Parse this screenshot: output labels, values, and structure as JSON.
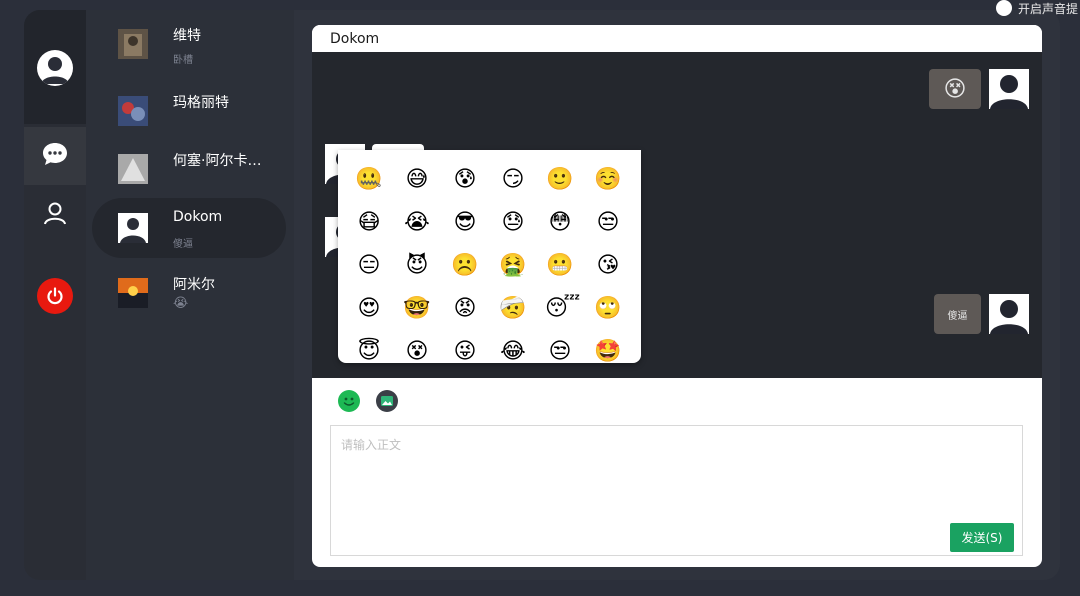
{
  "sound_toggle": {
    "label": "开启声音提",
    "enabled": false
  },
  "rail": {
    "items": [
      {
        "name": "chat",
        "icon": "chat-bubble-icon",
        "active": true
      },
      {
        "name": "contacts",
        "icon": "user-icon",
        "active": false
      },
      {
        "name": "logout",
        "icon": "power-icon",
        "active": false
      }
    ]
  },
  "chats": [
    {
      "name": "维特",
      "preview": "卧槽",
      "avatar_color": "#5e5346"
    },
    {
      "name": "玛格丽特",
      "preview": "",
      "avatar_color": "#3a4c78"
    },
    {
      "name": "何塞·阿尔卡…",
      "preview": "",
      "avatar_color": "#a9a9a9"
    },
    {
      "name": "Dokom",
      "preview": "傻逼",
      "avatar_color": "#ffffff",
      "active": true
    },
    {
      "name": "阿米尔",
      "preview": "😭",
      "avatar_color": "#e06b1b"
    }
  ],
  "conversation": {
    "title": "Dokom",
    "messages": [
      {
        "side": "right",
        "type": "emoji",
        "content": "😵"
      },
      {
        "side": "left",
        "type": "text",
        "content": ""
      },
      {
        "side": "left",
        "type": "text",
        "content": ""
      },
      {
        "side": "right",
        "type": "text",
        "content": "傻逼"
      }
    ]
  },
  "emoji_panel": {
    "rows": [
      [
        "🤐",
        "😅",
        "😰",
        "😏",
        "🙂",
        "☺️"
      ],
      [
        "😷",
        "😭",
        "😎",
        "😓",
        "😳",
        "😒"
      ],
      [
        "😑",
        "😈",
        "☹️",
        "🤮",
        "😬",
        "😘"
      ],
      [
        "😍",
        "🤓",
        "😡",
        "🤕",
        "😴",
        "🙄"
      ],
      [
        "😇",
        "😵",
        "😜",
        "😂",
        "😒",
        "🤩"
      ]
    ]
  },
  "toolbar": {
    "emoji_icon": "smiley-icon",
    "image_icon": "image-icon"
  },
  "composer": {
    "placeholder": "请输入正文",
    "value": "",
    "send_label": "发送(S)"
  }
}
